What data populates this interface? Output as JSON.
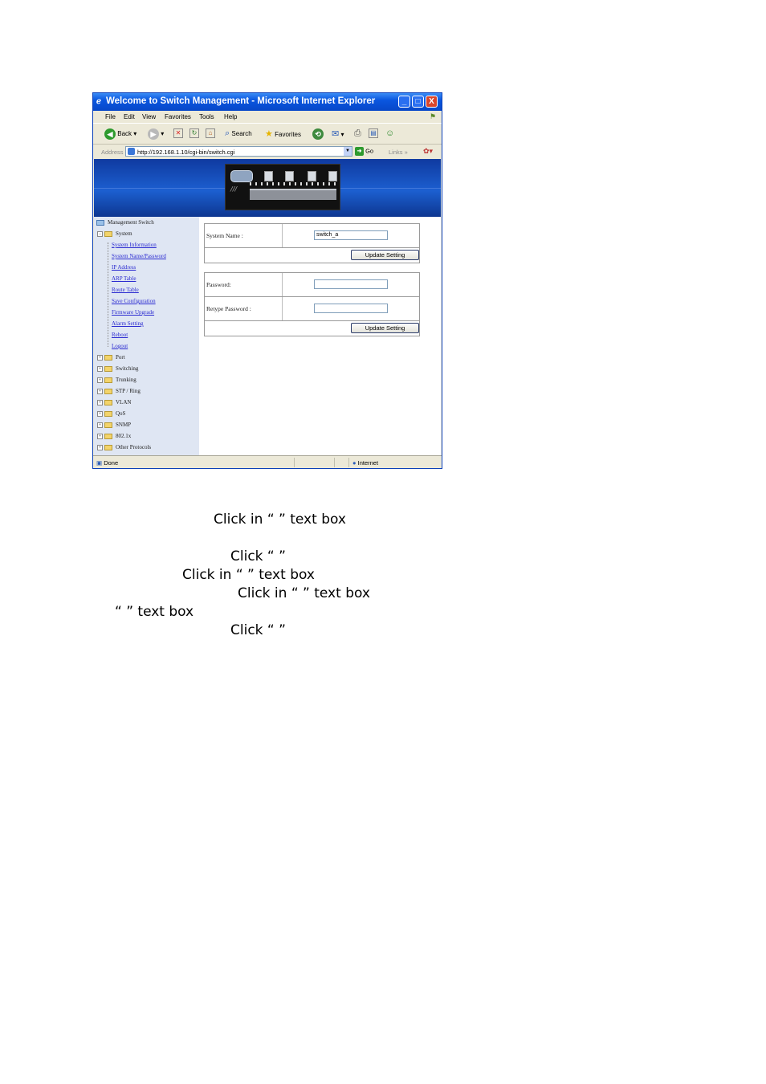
{
  "window": {
    "title": "Welcome to Switch Management - Microsoft Internet Explorer",
    "min_glyph": "_",
    "max_glyph": "□",
    "close_glyph": "X"
  },
  "menu": [
    "File",
    "Edit",
    "View",
    "Favorites",
    "Tools",
    "Help"
  ],
  "toolbar": {
    "back_label": "Back",
    "search_label": "Search",
    "favorites_label": "Favorites"
  },
  "address": {
    "label": "Address",
    "url": "http://192.168.1.10/cgi-bin/switch.cgi",
    "go_label": "Go",
    "links_label": "Links"
  },
  "nav": {
    "root": "Management Switch",
    "system": "System",
    "system_links": [
      "System Information",
      "System Name/Password",
      "IP Address",
      "ARP Table",
      "Route Table",
      "Save Configuration",
      "Firmware Upgrade",
      "Alarm Setting",
      "Reboot",
      "Logout"
    ],
    "folders": [
      "Port",
      "Switching",
      "Trunking",
      "STP / Ring",
      "VLAN",
      "QoS",
      "SNMP",
      "802.1x",
      "Other Protocols"
    ]
  },
  "form1": {
    "system_name_label": "System Name :",
    "system_name_value": "switch_a",
    "update_label": "Update Setting"
  },
  "form2": {
    "password_label": "Password:",
    "retype_label": "Retype Password :",
    "update_label": "Update Setting"
  },
  "status": {
    "left": "Done",
    "right": "Internet"
  },
  "instructions": [
    {
      "text": "Click in “                  ” text box"
    },
    {
      "text": "Click “                        ”"
    },
    {
      "text": "Click in “            ” text box"
    },
    {
      "text": "Click  in  “                      ”  text  box"
    },
    {
      "text": "“            ” text box"
    },
    {
      "text": "Click “                        ”"
    }
  ]
}
